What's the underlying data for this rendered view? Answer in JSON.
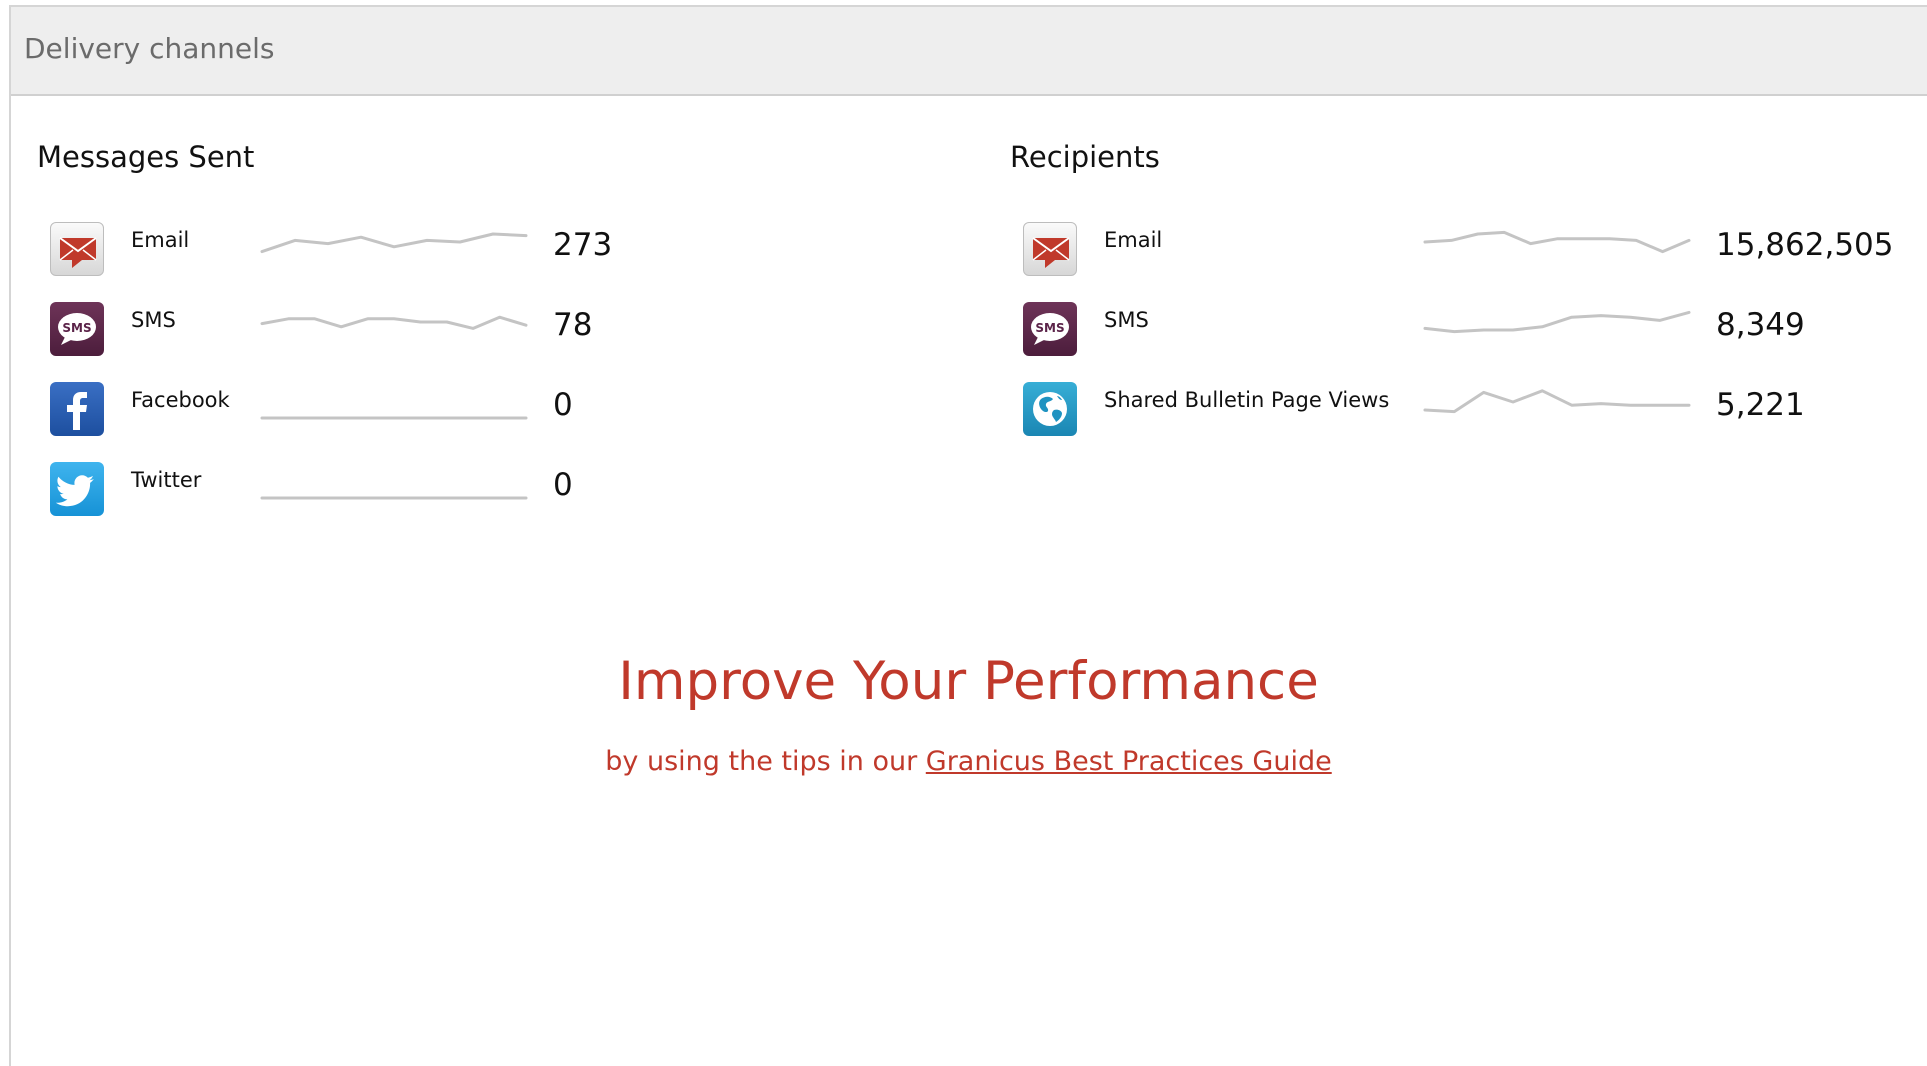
{
  "panel": {
    "title": "Delivery channels"
  },
  "messages_sent": {
    "title": "Messages Sent",
    "rows": [
      {
        "label": "Email",
        "value": "273",
        "icon": "email-icon",
        "trend": [
          0.2,
          0.55,
          0.45,
          0.65,
          0.35,
          0.55,
          0.5,
          0.75,
          0.7
        ]
      },
      {
        "label": "SMS",
        "value": "78",
        "icon": "sms-icon",
        "trend": [
          0.45,
          0.6,
          0.6,
          0.35,
          0.6,
          0.6,
          0.5,
          0.5,
          0.3,
          0.65,
          0.4
        ]
      },
      {
        "label": "Facebook",
        "value": "0",
        "icon": "facebook-icon",
        "trend": [
          0,
          0
        ]
      },
      {
        "label": "Twitter",
        "value": "0",
        "icon": "twitter-icon",
        "trend": [
          0,
          0
        ]
      }
    ]
  },
  "recipients": {
    "title": "Recipients",
    "rows": [
      {
        "label": "Email",
        "value": "15,862,505",
        "icon": "email-icon",
        "trend": [
          0.5,
          0.55,
          0.75,
          0.8,
          0.45,
          0.6,
          0.6,
          0.6,
          0.55,
          0.2,
          0.55
        ]
      },
      {
        "label": "SMS",
        "value": "8,349",
        "icon": "sms-icon",
        "trend": [
          0.3,
          0.2,
          0.25,
          0.25,
          0.35,
          0.65,
          0.7,
          0.65,
          0.55,
          0.8
        ]
      },
      {
        "label": "Shared Bulletin Page Views",
        "value": "5,221",
        "icon": "globe-icon",
        "trend": [
          0.25,
          0.2,
          0.8,
          0.5,
          0.85,
          0.4,
          0.45,
          0.4,
          0.4,
          0.4
        ]
      }
    ]
  },
  "promo": {
    "title": "Improve Your Performance",
    "lead_text": "by using the tips in our ",
    "link_text": "Granicus Best Practices Guide"
  },
  "colors": {
    "accent_red": "#c0392b",
    "sparkline": "#c4c4c4",
    "header_bg": "#eeeeee"
  }
}
